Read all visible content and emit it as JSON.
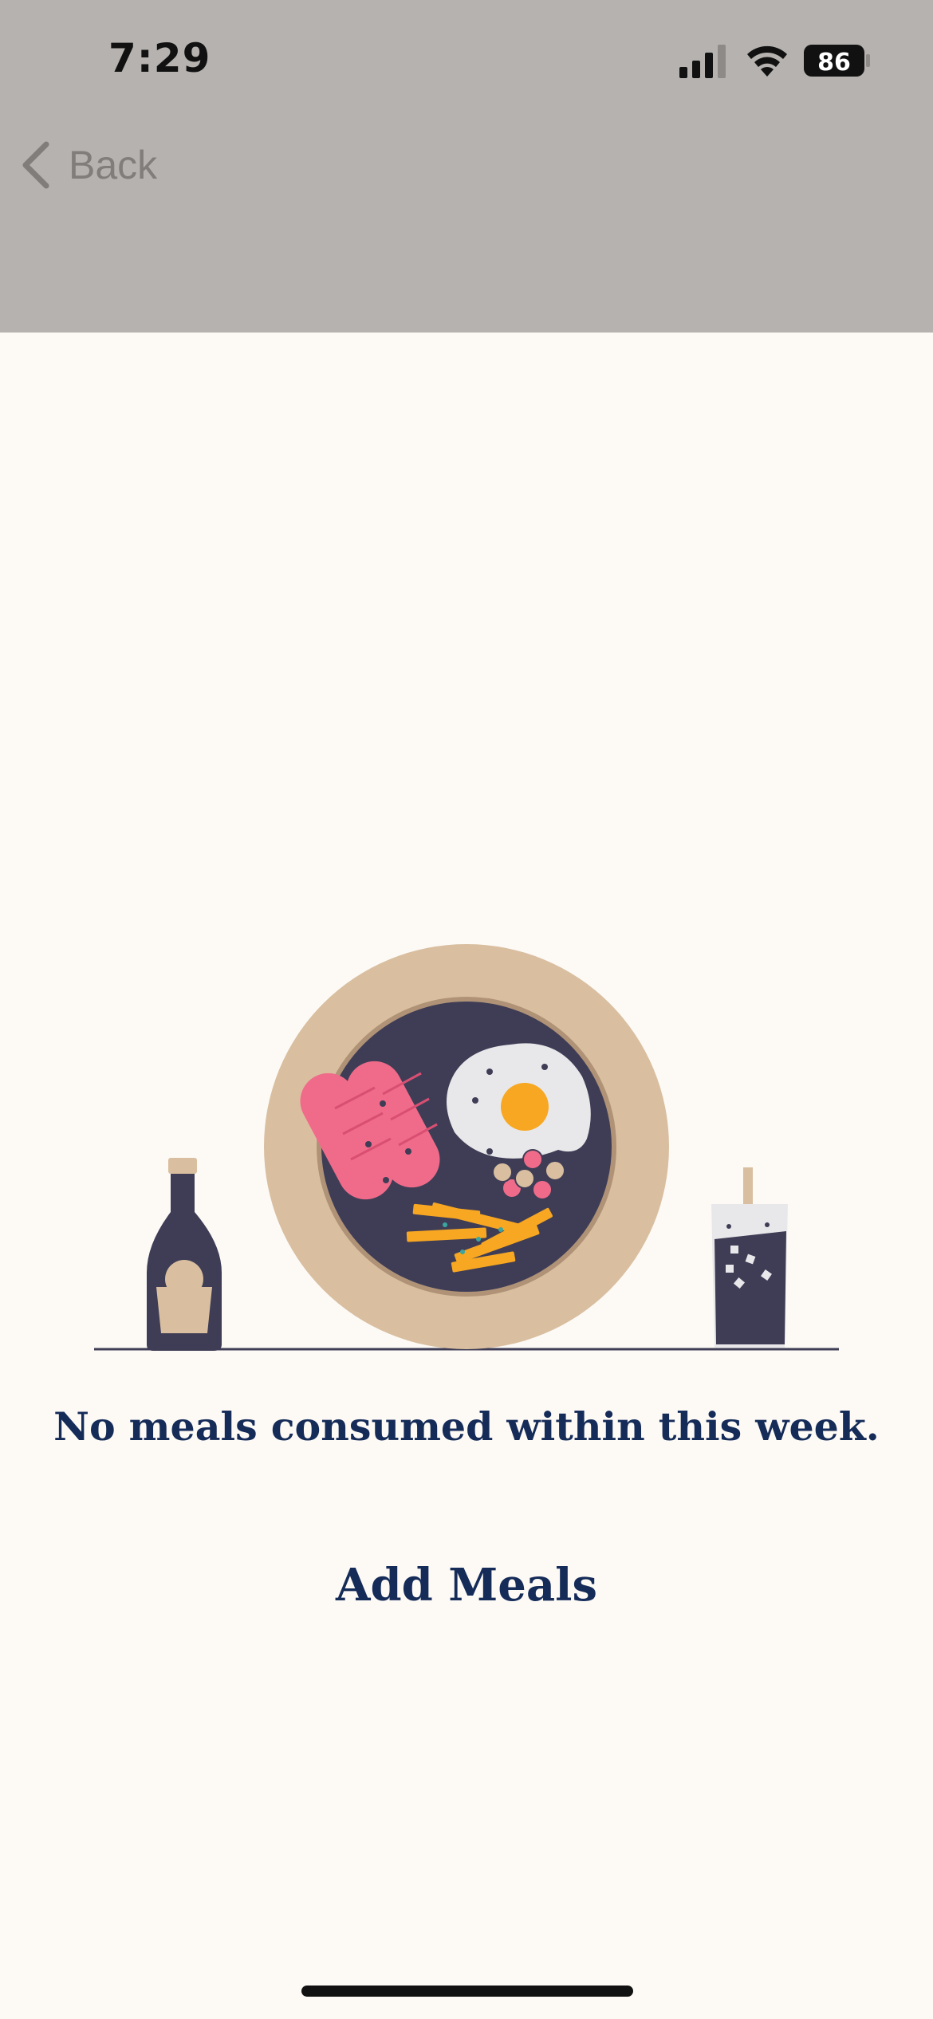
{
  "status_bar": {
    "time": "7:29",
    "battery_level": "86",
    "icons": [
      "cellular-signal-icon",
      "wifi-icon",
      "battery-icon"
    ]
  },
  "nav": {
    "back_label": "Back",
    "back_icon": "chevron-left-icon"
  },
  "illustration": {
    "name": "meal-plate-illustration",
    "elements": [
      "sauce-bottle",
      "plate",
      "sausages",
      "fried-egg",
      "berries",
      "fries",
      "drink-glass",
      "table-line"
    ]
  },
  "empty_state": {
    "message": "No meals consumed within this week.",
    "action_label": "Add Meals"
  },
  "colors": {
    "header_background": "#b5b2af",
    "page_background": "#fdfaf6",
    "primary_text": "#152b58",
    "back_text": "#807d7a",
    "plate_rim": "#d9bfa0",
    "plate_center": "#3f3d56",
    "sausage": "#f06b8a",
    "egg_yolk": "#f7a721",
    "fries": "#f7a721"
  }
}
